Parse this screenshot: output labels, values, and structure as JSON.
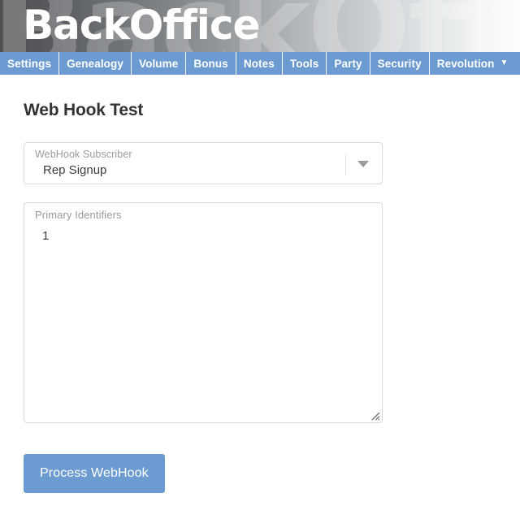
{
  "banner": {
    "title": "BackOffice",
    "watermark": "BackOffice"
  },
  "nav": {
    "items": [
      {
        "label": "Settings"
      },
      {
        "label": "Genealogy"
      },
      {
        "label": "Volume"
      },
      {
        "label": "Bonus"
      },
      {
        "label": "Notes"
      },
      {
        "label": "Tools"
      },
      {
        "label": "Party"
      },
      {
        "label": "Security"
      },
      {
        "label": "Revolution",
        "caret": "▼"
      }
    ]
  },
  "page": {
    "title": "Web Hook Test"
  },
  "form": {
    "subscriber": {
      "label": "WebHook Subscriber",
      "value": "Rep Signup",
      "arrow_icon": "chevron-down-icon"
    },
    "identifiers": {
      "label": "Primary Identifiers",
      "value": "1",
      "placeholder": "Primary Identifiers",
      "resize_icon": "resize-grip-icon"
    },
    "submit": {
      "label": "Process WebHook"
    }
  },
  "colors": {
    "accent": "#6b9bd1",
    "nav_background": "#6b9bd1",
    "button_background": "#6b9bd1",
    "title_text": "#333333",
    "field_border": "#dadada",
    "label_text": "#9a9a9a",
    "value_text": "#3c3c3c"
  }
}
